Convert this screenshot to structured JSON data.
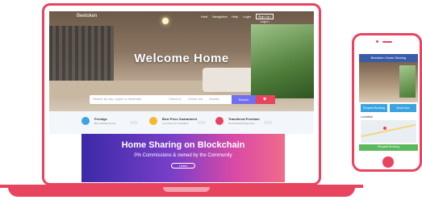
{
  "laptop": {
    "nav": {
      "logo": "Beetoken",
      "links": [
        "Host",
        "Navigation",
        "Help",
        "Login"
      ],
      "button": "Sign Up / Log In"
    },
    "hero": {
      "title": "Welcome Home",
      "search": {
        "placeholder": "Search by city, region or landmark",
        "check_in": "Check in",
        "check_out": "Check out",
        "guests": "Guests",
        "button": "Search"
      }
    },
    "features": [
      {
        "title": "Prestige",
        "subtitle": "Bee Verified Homes",
        "color": "#3aa3e0"
      },
      {
        "title": "Best Price Guaranteed",
        "subtitle": "Low prices for Travellers",
        "color": "#f1b830"
      },
      {
        "title": "Transferral Freedom",
        "subtitle": "Decentralized Payments",
        "color": "#e8435f"
      }
    ],
    "banner": {
      "title": "Home Sharing on Blockchain",
      "subtitle": "0% Commissions & owned by the Community",
      "button": "Learn"
    }
  },
  "phone": {
    "header": "Beetoken Home Sharing",
    "buttons": [
      "Request Booking",
      "Book Now"
    ],
    "location_label": "Location",
    "footer": "Request Booking"
  },
  "colors": {
    "brand": "#e8435f",
    "accent": "#6f6ff0",
    "phone_button": "#3aa3e0",
    "phone_footer": "#5cb85c"
  }
}
